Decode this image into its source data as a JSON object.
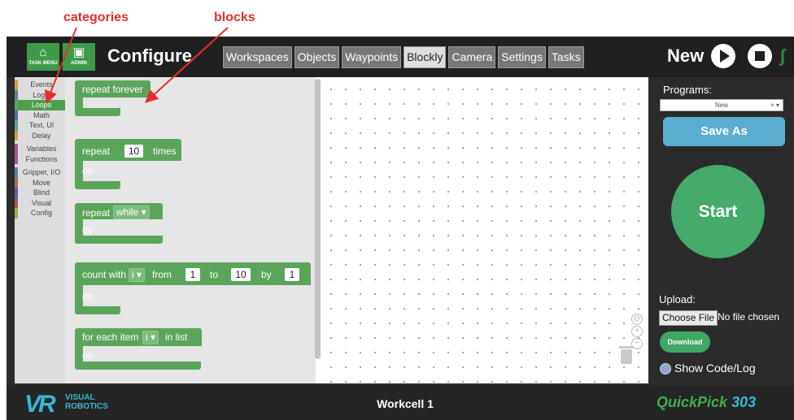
{
  "annotations": {
    "categories": "categories",
    "blocks": "blocks"
  },
  "header": {
    "task_menu_label": "TASK MENU",
    "admin_label": "ADMIN",
    "title": "Configure",
    "tabs": [
      {
        "label": "Workspaces",
        "active": false
      },
      {
        "label": "Objects",
        "active": false
      },
      {
        "label": "Waypoints",
        "active": false
      },
      {
        "label": "Blockly",
        "active": true
      },
      {
        "label": "Camera",
        "active": false
      },
      {
        "label": "Settings",
        "active": false
      },
      {
        "label": "Tasks",
        "active": false
      }
    ],
    "program_name": "New",
    "icons": [
      "home-icon",
      "lock-icon",
      "play-icon",
      "stop-icon",
      "robot-icon"
    ]
  },
  "toolbox": {
    "categories": [
      {
        "label": "Events",
        "color": "#caa244"
      },
      {
        "label": "Logic",
        "color": "#5b80a5"
      },
      {
        "label": "Loops",
        "color": "#5ba55b",
        "selected": true
      },
      {
        "label": "Math",
        "color": "#5b67a5"
      },
      {
        "label": "Text, UI",
        "color": "#5ba58c"
      },
      {
        "label": "Delay",
        "color": "#c8a445"
      },
      {
        "label": "Variables",
        "color": "#a55b80"
      },
      {
        "label": "Functions",
        "color": "#995ba5"
      },
      {
        "label": "Gripper, I/O",
        "color": "#5b80a5"
      },
      {
        "label": "Move",
        "color": "#a5745b"
      },
      {
        "label": "Blind",
        "color": "#5b5ba5"
      },
      {
        "label": "Visual",
        "color": "#a55b5b"
      },
      {
        "label": "Config",
        "color": "#a5a55b"
      }
    ]
  },
  "blocks": {
    "repeat_forever": "repeat forever",
    "repeat_times": {
      "repeat": "repeat",
      "count": "10",
      "times": "times",
      "do": "do"
    },
    "repeat_while": {
      "repeat": "repeat",
      "mode": "while",
      "do": "do"
    },
    "count_with": {
      "count_with": "count with",
      "var": "i",
      "from": "from",
      "from_val": "1",
      "to": "to",
      "to_val": "10",
      "by": "by",
      "by_val": "1",
      "do": "do"
    },
    "for_each": {
      "for_each_item": "for each item",
      "var": "i",
      "in_list": "in list",
      "do": "do"
    }
  },
  "sidebar": {
    "programs_label": "Programs:",
    "program_selected": "New",
    "save_as": "Save As",
    "start": "Start",
    "upload_label": "Upload:",
    "choose_file": "Choose File",
    "no_file": "No file chosen",
    "download": "Download",
    "show_code": "Show Code/Log"
  },
  "footer": {
    "brand_mark": "VR",
    "brand_line1": "VISUAL",
    "brand_line2": "ROBOTICS",
    "workcell": "Workcell 1",
    "product_name": "QuickPick",
    "product_number": "303"
  },
  "colors": {
    "annotation": "#e3302f",
    "block_green": "#5ba55b",
    "save_as": "#5baed0",
    "start": "#45aa6a",
    "brand_blue": "#39b8d4",
    "quickpick_green": "#3fae4d"
  }
}
